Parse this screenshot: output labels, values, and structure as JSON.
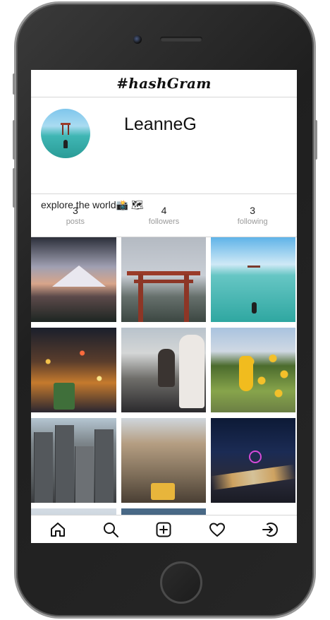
{
  "app": {
    "title": "#hashGram"
  },
  "profile": {
    "username": "LeanneG",
    "bio": "explore the world📸 🗺"
  },
  "stats": [
    {
      "value": "3",
      "label": "posts"
    },
    {
      "value": "4",
      "label": "followers"
    },
    {
      "value": "3",
      "label": "following"
    }
  ],
  "nav": [
    {
      "name": "home-icon"
    },
    {
      "name": "search-icon"
    },
    {
      "name": "add-post-icon"
    },
    {
      "name": "heart-icon"
    },
    {
      "name": "logout-icon"
    }
  ]
}
